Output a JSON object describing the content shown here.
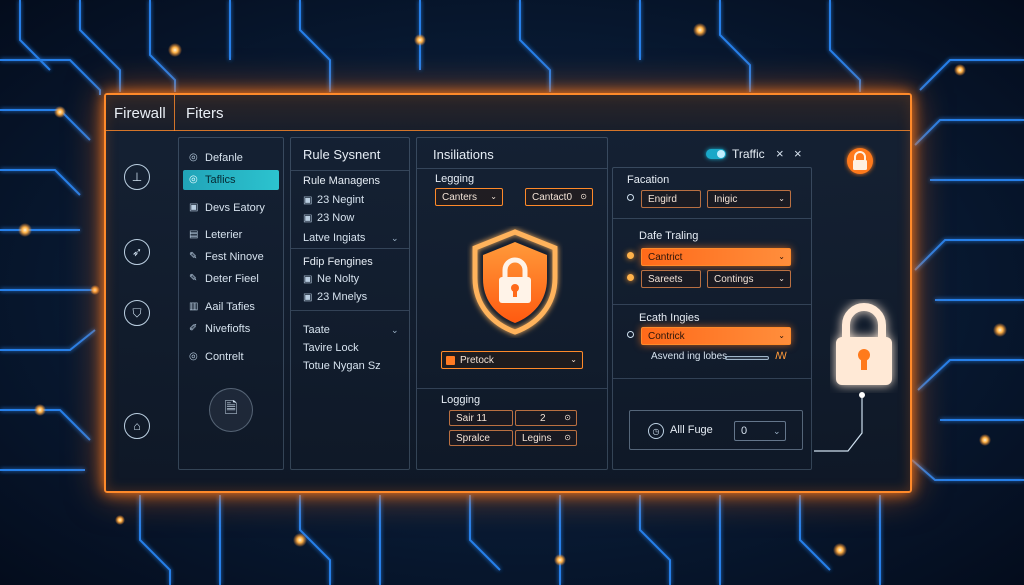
{
  "titlebar": {
    "app": "Firewall",
    "section": "Fiters"
  },
  "rail": {
    "buttons": [
      {
        "name": "download-icon",
        "glyph": "⊥"
      },
      {
        "name": "rocket-icon",
        "glyph": "➶"
      },
      {
        "name": "shield-check-icon",
        "glyph": "⛉"
      },
      {
        "name": "home-icon",
        "glyph": "⌂"
      }
    ]
  },
  "nav": {
    "items": [
      {
        "label": "Defanle",
        "glyph": "◎"
      },
      {
        "label": "Taflics",
        "glyph": "◎"
      },
      {
        "label": "Devs Eatory",
        "glyph": "▣"
      },
      {
        "label": "Leterier",
        "glyph": "▤"
      },
      {
        "label": "Fest Ninove",
        "glyph": "✎"
      },
      {
        "label": "Deter Fieel",
        "glyph": "✎"
      },
      {
        "label": "Aail Tafies",
        "glyph": "▥"
      },
      {
        "label": "Nivefiofts",
        "glyph": "✐"
      },
      {
        "label": "Contrelt",
        "glyph": "◎"
      }
    ],
    "file_glyph": "🗎"
  },
  "rules": {
    "header": "Rule Sysnent",
    "group1_title": "Rule Managens",
    "group1_items": [
      "23 Negint",
      "23 Now"
    ],
    "group1_footer": "Latve Ingiats",
    "group2_title": "Fdip Fengines",
    "group2_items": [
      "Ne Nolty",
      "23 Mnelys"
    ],
    "group3_title": "Taate",
    "group3_items": [
      "Tavire Lock",
      "Totue Nygan Sz"
    ]
  },
  "installs": {
    "header": "Insiliations",
    "logging_title": "Legging",
    "field_a": "Canters",
    "field_b": "Cantact0",
    "protect_field": "Pretock",
    "logging2_title": "Logging",
    "row1": [
      "Sair 11",
      "2"
    ],
    "row2": [
      "Spralce",
      "Legins"
    ]
  },
  "traffic": {
    "toggle_label": "Traffic",
    "close_glyph": "×",
    "facation_title": "Facation",
    "fac_field1": "Engird",
    "fac_field2": "Inigic",
    "safe_title": "Dafe Traling",
    "safe_field1": "Cantrict",
    "safe_field2": "Sareets",
    "safe_field3": "Contings",
    "each_title": "Ecath Ingies",
    "each_field": "Contrick",
    "slider_label": "Asvend ing lobes",
    "slider_end": "ꟿ",
    "all_label": "Alll Fuge",
    "all_value": "0"
  },
  "colors": {
    "accent": "#ff8a2a",
    "cyan": "#2cc3cf",
    "circuit": "#1e90ff"
  }
}
